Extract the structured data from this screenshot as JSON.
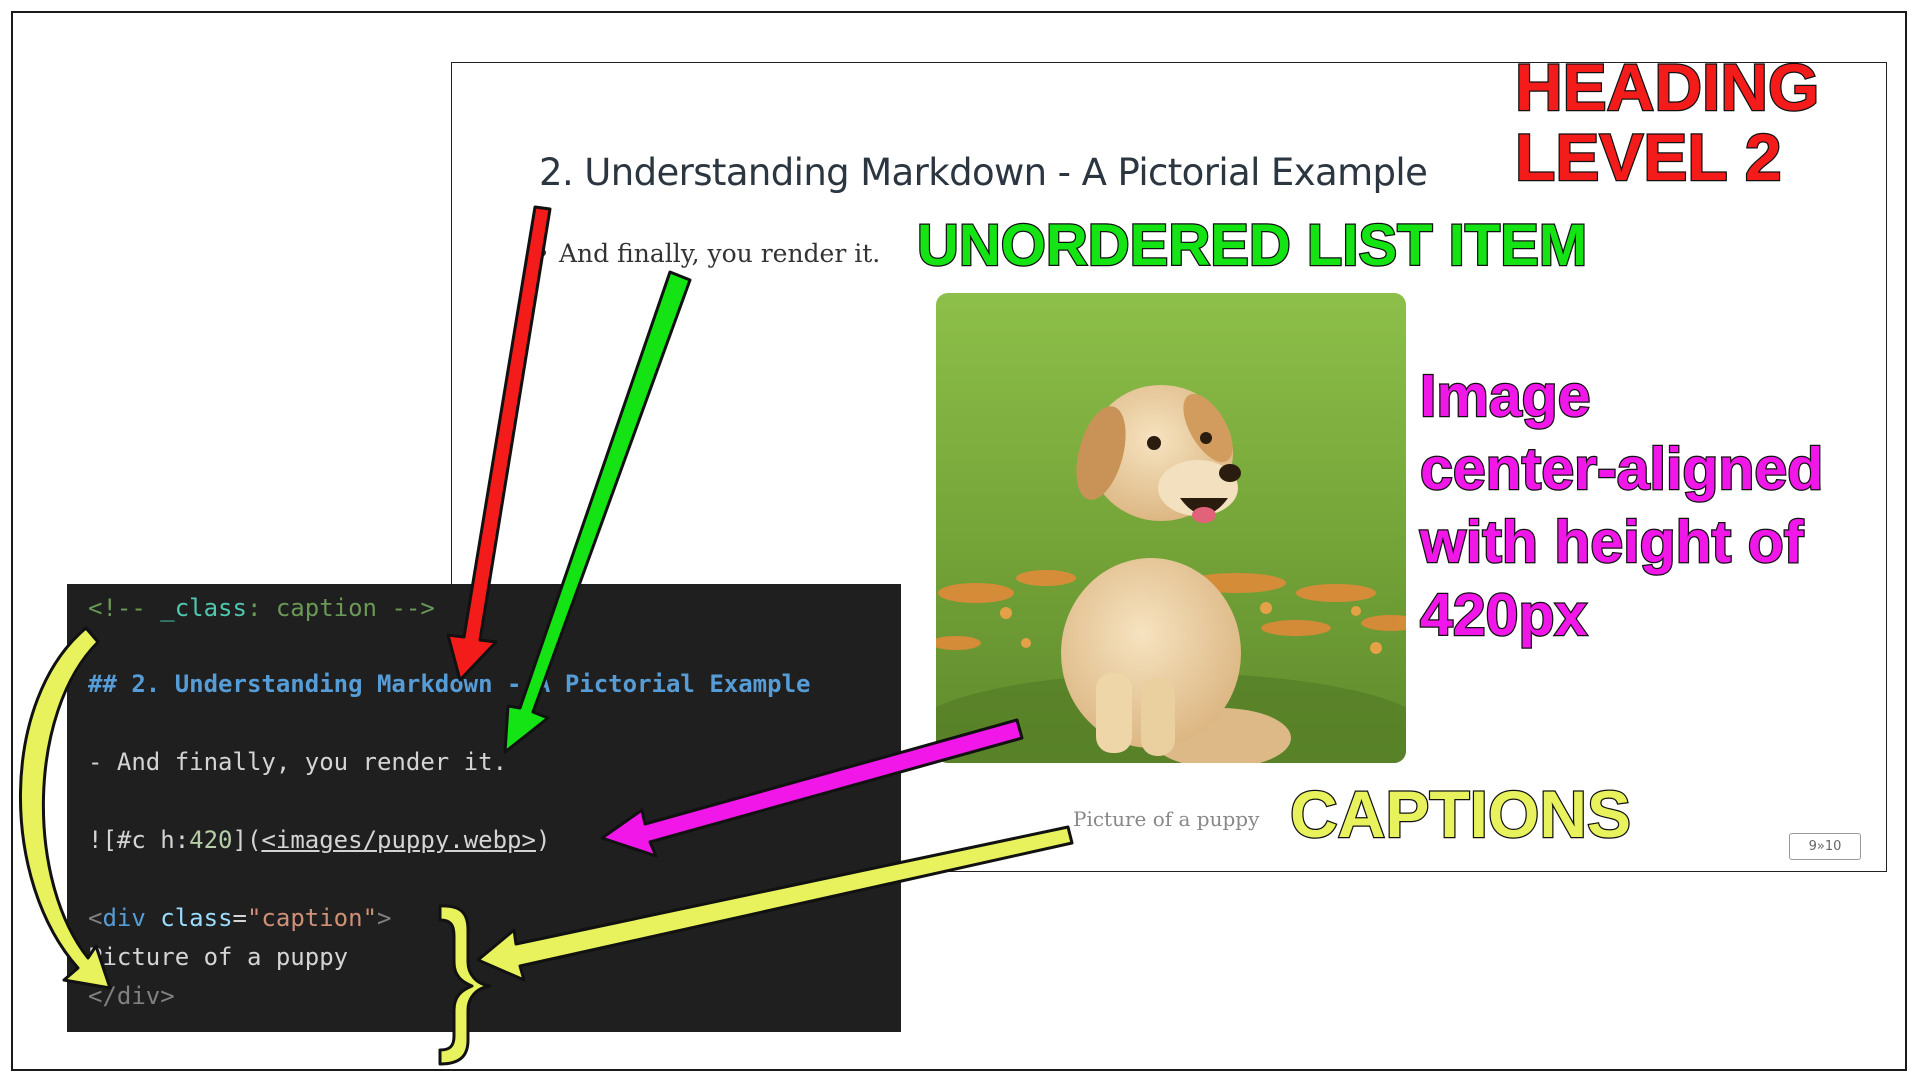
{
  "slide": {
    "heading": "2. Understanding Markdown - A Pictorial Example",
    "bullet": "And finally, you render it.",
    "caption": "Picture of a puppy",
    "page_number": "9»10",
    "image_icon": "puppy-photo"
  },
  "code": {
    "line1": {
      "open": "<!-- ",
      "class_key": "_class",
      "sep": ": ",
      "value": "caption",
      "close": " -->"
    },
    "line2": "## 2. Understanding Markdown - A Pictorial Example",
    "line3": "- And finally, you render it.",
    "line4": {
      "prefix": "![#c ",
      "h_key": "h:",
      "h_value": "420",
      "mid": "](",
      "link": "<images/puppy.webp>",
      "end": ")"
    },
    "line5": {
      "open": "<",
      "tag": "div",
      "space": " ",
      "attr": "class",
      "eq": "=",
      "value": "\"caption\"",
      "close": ">"
    },
    "line6": "Picture of a puppy",
    "line7": "</div>"
  },
  "annotations": {
    "heading_line1": "HEADING",
    "heading_line2": "LEVEL 2",
    "list": "UNORDERED LIST ITEM",
    "image_line1": "Image",
    "image_line2": "center-aligned",
    "image_line3": "with height of",
    "image_line4": "420px",
    "captions": "CAPTIONS"
  },
  "colors": {
    "heading_annotation": "#f41b1b",
    "list_annotation": "#14e414",
    "image_annotation": "#f017e8",
    "caption_annotation": "#e7f25c",
    "code_background": "#1f1f1f"
  }
}
